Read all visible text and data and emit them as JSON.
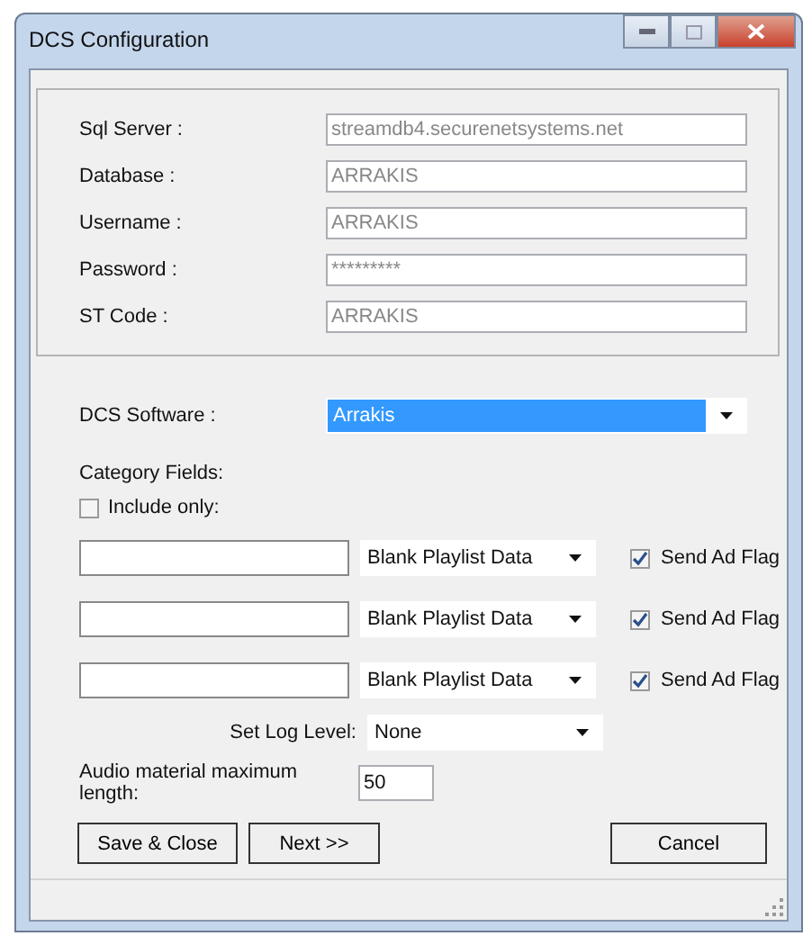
{
  "window": {
    "title": "DCS Configuration"
  },
  "connection_fields": [
    {
      "label": "Sql Server :",
      "value": "streamdb4.securenetsystems.net"
    },
    {
      "label": "Database :",
      "value": "ARRAKIS"
    },
    {
      "label": "Username :",
      "value": "ARRAKIS"
    },
    {
      "label": "Password :",
      "value": "*********"
    },
    {
      "label": "ST Code :",
      "value": "ARRAKIS"
    }
  ],
  "software": {
    "label": "DCS Software :",
    "value": "Arrakis",
    "selected": true
  },
  "category": {
    "label": "Category Fields:",
    "include_only": {
      "label": "Include only:",
      "checked": false
    },
    "rows": [
      {
        "dropdown": "Blank Playlist Data",
        "flag_label": "Send Ad Flag",
        "checked": true
      },
      {
        "dropdown": "Blank Playlist Data",
        "flag_label": "Send Ad Flag",
        "checked": true
      },
      {
        "dropdown": "Blank Playlist Data",
        "flag_label": "Send Ad Flag",
        "checked": true
      }
    ]
  },
  "log_level": {
    "label": "Set Log Level:",
    "value": "None"
  },
  "audio_length": {
    "label": "Audio material maximum length:",
    "value": "50"
  },
  "buttons": [
    {
      "label": "Save & Close"
    },
    {
      "label": "Next >>"
    },
    {
      "label": "Cancel"
    }
  ]
}
